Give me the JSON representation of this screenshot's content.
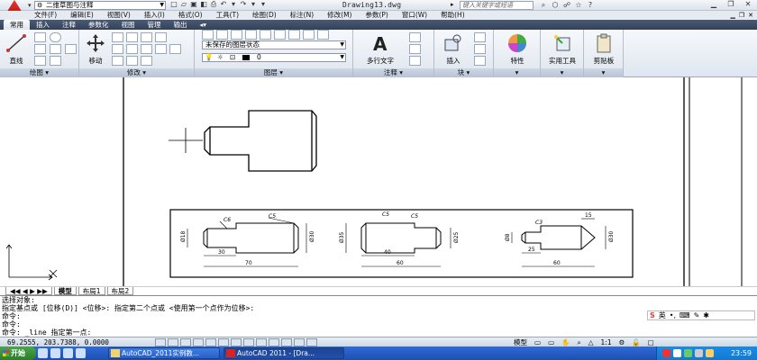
{
  "titlebar": {
    "workspace": "二维草图与注释",
    "doc_title": "Drawing13.dwg",
    "help_search_placeholder": "键入关键字或短语"
  },
  "menubar": {
    "items": [
      "文件(F)",
      "编辑(E)",
      "视图(V)",
      "插入(I)",
      "格式(O)",
      "工具(T)",
      "绘图(D)",
      "标注(N)",
      "修改(M)",
      "参数(P)",
      "窗口(W)",
      "帮助(H)"
    ]
  },
  "ribbon_tabs": {
    "items": [
      "常用",
      "插入",
      "注释",
      "参数化",
      "视图",
      "管理",
      "输出"
    ],
    "active": "常用"
  },
  "ribbon": {
    "draw": {
      "title": "绘图",
      "line_label": "直线"
    },
    "modify": {
      "title": "修改",
      "move_label": "移动"
    },
    "layers": {
      "title": "图层",
      "layer_state": "未保存的图层状态",
      "current_layer": "0"
    },
    "annotation": {
      "title": "注释",
      "mtext_label": "多行文字"
    },
    "block": {
      "title": "块",
      "insert_label": "插入"
    },
    "properties": {
      "label": "特性"
    },
    "utilities": {
      "label": "实用工具"
    },
    "clipboard": {
      "label": "剪贴板"
    }
  },
  "drawing": {
    "dims_fig1": [
      "C6",
      "C5",
      "Ø18",
      "Ø30",
      "30",
      "70"
    ],
    "dims_fig2": [
      "C5",
      "C5",
      "Ø35",
      "Ø25",
      "40",
      "60"
    ],
    "dims_fig3": [
      "C3",
      "15",
      "Ø8",
      "Ø30",
      "25",
      "60"
    ]
  },
  "layout_tabs": {
    "items": [
      "模型",
      "布局1",
      "布局2"
    ],
    "active": "模型"
  },
  "cmdline": {
    "lines": [
      "选择对象:",
      "指定基点或 [位移(D)] <位移>:  指定第二个点或 <使用第一个点作为位移>:",
      "命令:",
      "命令:",
      "命令: _line 指定第一点:"
    ]
  },
  "ime": {
    "mode": "英"
  },
  "statusbar": {
    "coords": "69.2555,  203.7388,  0.0000",
    "model_label": "模型",
    "scale": "1:1"
  },
  "taskbar": {
    "start": "开始",
    "tasks": [
      "AutoCAD_2011实例教...",
      "AutoCAD 2011 - [Dra..."
    ],
    "clock": "23:59"
  }
}
